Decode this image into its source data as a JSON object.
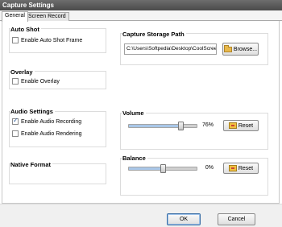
{
  "window": {
    "title": "Capture Settings"
  },
  "tabs": [
    {
      "label": "General",
      "active": true
    },
    {
      "label": "Screen Record",
      "active": false
    }
  ],
  "auto_shot": {
    "title": "Auto Shot",
    "enable_frame_label": "Enable Auto Shot Frame",
    "enable_frame_checked": false
  },
  "overlay": {
    "title": "Overlay",
    "enable_label": "Enable Overlay",
    "enable_checked": false
  },
  "audio": {
    "title": "Audio Settings",
    "recording_label": "Enable Audio Recording",
    "recording_checked": true,
    "rendering_label": "Enable Audio Rendering",
    "rendering_checked": false
  },
  "native_format": {
    "title": "Native Format"
  },
  "storage": {
    "title": "Capture Storage Path",
    "path": "C:\\Users\\Softpedia\\Desktop\\CoolScree",
    "browse_label": "Browse..."
  },
  "volume": {
    "title": "Volume",
    "value_percent": 76,
    "value_text": "76%",
    "reset_label": "Reset"
  },
  "balance": {
    "title": "Balance",
    "value_percent": 0,
    "value_text": "0%",
    "reset_label": "Reset"
  },
  "footer": {
    "ok_label": "OK",
    "cancel_label": "Cancel"
  },
  "colors": {
    "title_bar": "#555555",
    "fill": "#a9c7e8",
    "folder": "#e8b84a"
  },
  "icons": {
    "browse": "folder-icon",
    "reset": "reset-icon"
  }
}
